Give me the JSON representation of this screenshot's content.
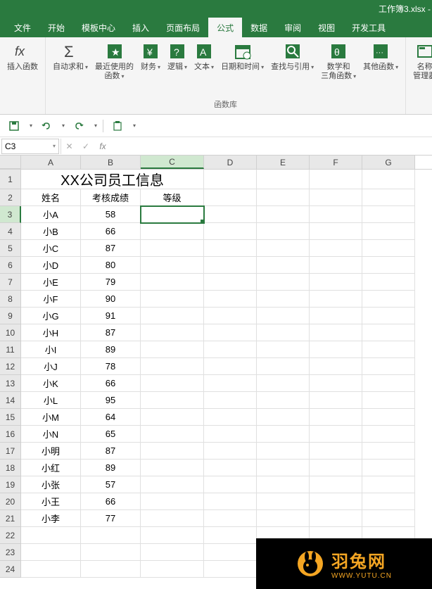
{
  "window": {
    "title": "工作簿3.xlsx - "
  },
  "menu": {
    "items": [
      "文件",
      "开始",
      "模板中心",
      "插入",
      "页面布局",
      "公式",
      "数据",
      "审阅",
      "视图",
      "开发工具"
    ],
    "active_index": 5
  },
  "ribbon": {
    "groups": [
      {
        "label": "",
        "buttons": [
          {
            "name": "insert-function",
            "label": "插入函数",
            "icon": "fx"
          }
        ]
      },
      {
        "label": "函数库",
        "buttons": [
          {
            "name": "autosum",
            "label": "自动求和",
            "icon": "sigma",
            "dropdown": true
          },
          {
            "name": "recent",
            "label": "最近使用的\n函数",
            "icon": "star",
            "dropdown": true
          },
          {
            "name": "financial",
            "label": "财务",
            "icon": "fin",
            "dropdown": true
          },
          {
            "name": "logical",
            "label": "逻辑",
            "icon": "logic",
            "dropdown": true
          },
          {
            "name": "text",
            "label": "文本",
            "icon": "text",
            "dropdown": true
          },
          {
            "name": "datetime",
            "label": "日期和时间",
            "icon": "date",
            "dropdown": true
          },
          {
            "name": "lookup",
            "label": "查找与引用",
            "icon": "lookup",
            "dropdown": true
          },
          {
            "name": "math",
            "label": "数学和\n三角函数",
            "icon": "math",
            "dropdown": true
          },
          {
            "name": "other",
            "label": "其他函数",
            "icon": "other",
            "dropdown": true
          }
        ]
      },
      {
        "label": "",
        "buttons": [
          {
            "name": "name-manager",
            "label": "名称\n管理器",
            "icon": "name"
          }
        ]
      }
    ]
  },
  "quick_access": {
    "save": "save",
    "undo": "undo",
    "redo": "redo",
    "paste": "paste"
  },
  "formula_bar": {
    "cell_ref": "C3",
    "cancel": "✕",
    "confirm": "✓",
    "fx": "fx",
    "value": ""
  },
  "grid": {
    "columns": [
      "A",
      "B",
      "C",
      "D",
      "E",
      "F",
      "G"
    ],
    "selected_col": "C",
    "selected_row": 3,
    "title": "XX公司员工信息",
    "headers": [
      "姓名",
      "考核成绩",
      "等级"
    ],
    "rows": [
      {
        "name": "小A",
        "score": 58
      },
      {
        "name": "小B",
        "score": 66
      },
      {
        "name": "小C",
        "score": 87
      },
      {
        "name": "小D",
        "score": 80
      },
      {
        "name": "小E",
        "score": 79
      },
      {
        "name": "小F",
        "score": 90
      },
      {
        "name": "小G",
        "score": 91
      },
      {
        "name": "小H",
        "score": 87
      },
      {
        "name": "小I",
        "score": 89
      },
      {
        "name": "小J",
        "score": 78
      },
      {
        "name": "小K",
        "score": 66
      },
      {
        "name": "小L",
        "score": 95
      },
      {
        "name": "小M",
        "score": 64
      },
      {
        "name": "小N",
        "score": 65
      },
      {
        "name": "小明",
        "score": 87
      },
      {
        "name": "小红",
        "score": 89
      },
      {
        "name": "小张",
        "score": 57
      },
      {
        "name": "小王",
        "score": 66
      },
      {
        "name": "小李",
        "score": 77
      }
    ],
    "empty_rows": [
      22,
      23,
      24
    ]
  },
  "watermark": {
    "main": "羽兔网",
    "sub": "WWW.YUTU.CN"
  }
}
